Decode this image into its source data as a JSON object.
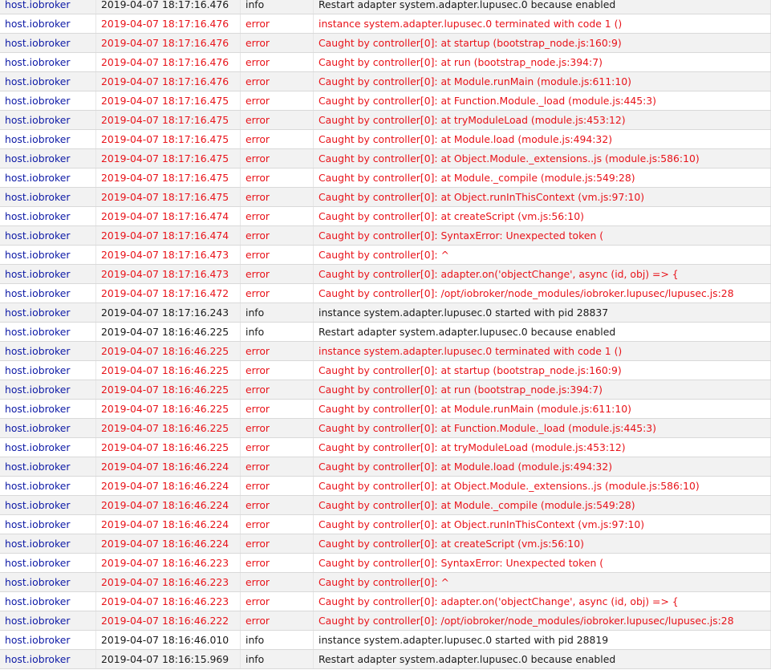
{
  "colors": {
    "source": "#0d1aa6",
    "error": "#e8131a",
    "info": "#1a1a1a",
    "row_alt": "#f2f2f2"
  },
  "log": {
    "rows": [
      {
        "source": "host.iobroker",
        "time": "2019-04-07 18:17:16.476",
        "severity": "info",
        "message": "Restart adapter system.adapter.lupusec.0 because enabled"
      },
      {
        "source": "host.iobroker",
        "time": "2019-04-07 18:17:16.476",
        "severity": "error",
        "message": "instance system.adapter.lupusec.0 terminated with code 1 ()"
      },
      {
        "source": "host.iobroker",
        "time": "2019-04-07 18:17:16.476",
        "severity": "error",
        "message": "Caught by controller[0]: at startup (bootstrap_node.js:160:9)"
      },
      {
        "source": "host.iobroker",
        "time": "2019-04-07 18:17:16.476",
        "severity": "error",
        "message": "Caught by controller[0]: at run (bootstrap_node.js:394:7)"
      },
      {
        "source": "host.iobroker",
        "time": "2019-04-07 18:17:16.476",
        "severity": "error",
        "message": "Caught by controller[0]: at Module.runMain (module.js:611:10)"
      },
      {
        "source": "host.iobroker",
        "time": "2019-04-07 18:17:16.475",
        "severity": "error",
        "message": "Caught by controller[0]: at Function.Module._load (module.js:445:3)"
      },
      {
        "source": "host.iobroker",
        "time": "2019-04-07 18:17:16.475",
        "severity": "error",
        "message": "Caught by controller[0]: at tryModuleLoad (module.js:453:12)"
      },
      {
        "source": "host.iobroker",
        "time": "2019-04-07 18:17:16.475",
        "severity": "error",
        "message": "Caught by controller[0]: at Module.load (module.js:494:32)"
      },
      {
        "source": "host.iobroker",
        "time": "2019-04-07 18:17:16.475",
        "severity": "error",
        "message": "Caught by controller[0]: at Object.Module._extensions..js (module.js:586:10)"
      },
      {
        "source": "host.iobroker",
        "time": "2019-04-07 18:17:16.475",
        "severity": "error",
        "message": "Caught by controller[0]: at Module._compile (module.js:549:28)"
      },
      {
        "source": "host.iobroker",
        "time": "2019-04-07 18:17:16.475",
        "severity": "error",
        "message": "Caught by controller[0]: at Object.runInThisContext (vm.js:97:10)"
      },
      {
        "source": "host.iobroker",
        "time": "2019-04-07 18:17:16.474",
        "severity": "error",
        "message": "Caught by controller[0]: at createScript (vm.js:56:10)"
      },
      {
        "source": "host.iobroker",
        "time": "2019-04-07 18:17:16.474",
        "severity": "error",
        "message": "Caught by controller[0]: SyntaxError: Unexpected token ("
      },
      {
        "source": "host.iobroker",
        "time": "2019-04-07 18:17:16.473",
        "severity": "error",
        "message": "Caught by controller[0]: ^"
      },
      {
        "source": "host.iobroker",
        "time": "2019-04-07 18:17:16.473",
        "severity": "error",
        "message": "Caught by controller[0]: adapter.on('objectChange', async (id, obj) => {"
      },
      {
        "source": "host.iobroker",
        "time": "2019-04-07 18:17:16.472",
        "severity": "error",
        "message": "Caught by controller[0]: /opt/iobroker/node_modules/iobroker.lupusec/lupusec.js:28"
      },
      {
        "source": "host.iobroker",
        "time": "2019-04-07 18:17:16.243",
        "severity": "info",
        "message": "instance system.adapter.lupusec.0 started with pid 28837"
      },
      {
        "source": "host.iobroker",
        "time": "2019-04-07 18:16:46.225",
        "severity": "info",
        "message": "Restart adapter system.adapter.lupusec.0 because enabled"
      },
      {
        "source": "host.iobroker",
        "time": "2019-04-07 18:16:46.225",
        "severity": "error",
        "message": "instance system.adapter.lupusec.0 terminated with code 1 ()"
      },
      {
        "source": "host.iobroker",
        "time": "2019-04-07 18:16:46.225",
        "severity": "error",
        "message": "Caught by controller[0]: at startup (bootstrap_node.js:160:9)"
      },
      {
        "source": "host.iobroker",
        "time": "2019-04-07 18:16:46.225",
        "severity": "error",
        "message": "Caught by controller[0]: at run (bootstrap_node.js:394:7)"
      },
      {
        "source": "host.iobroker",
        "time": "2019-04-07 18:16:46.225",
        "severity": "error",
        "message": "Caught by controller[0]: at Module.runMain (module.js:611:10)"
      },
      {
        "source": "host.iobroker",
        "time": "2019-04-07 18:16:46.225",
        "severity": "error",
        "message": "Caught by controller[0]: at Function.Module._load (module.js:445:3)"
      },
      {
        "source": "host.iobroker",
        "time": "2019-04-07 18:16:46.225",
        "severity": "error",
        "message": "Caught by controller[0]: at tryModuleLoad (module.js:453:12)"
      },
      {
        "source": "host.iobroker",
        "time": "2019-04-07 18:16:46.224",
        "severity": "error",
        "message": "Caught by controller[0]: at Module.load (module.js:494:32)"
      },
      {
        "source": "host.iobroker",
        "time": "2019-04-07 18:16:46.224",
        "severity": "error",
        "message": "Caught by controller[0]: at Object.Module._extensions..js (module.js:586:10)"
      },
      {
        "source": "host.iobroker",
        "time": "2019-04-07 18:16:46.224",
        "severity": "error",
        "message": "Caught by controller[0]: at Module._compile (module.js:549:28)"
      },
      {
        "source": "host.iobroker",
        "time": "2019-04-07 18:16:46.224",
        "severity": "error",
        "message": "Caught by controller[0]: at Object.runInThisContext (vm.js:97:10)"
      },
      {
        "source": "host.iobroker",
        "time": "2019-04-07 18:16:46.224",
        "severity": "error",
        "message": "Caught by controller[0]: at createScript (vm.js:56:10)"
      },
      {
        "source": "host.iobroker",
        "time": "2019-04-07 18:16:46.223",
        "severity": "error",
        "message": "Caught by controller[0]: SyntaxError: Unexpected token ("
      },
      {
        "source": "host.iobroker",
        "time": "2019-04-07 18:16:46.223",
        "severity": "error",
        "message": "Caught by controller[0]: ^"
      },
      {
        "source": "host.iobroker",
        "time": "2019-04-07 18:16:46.223",
        "severity": "error",
        "message": "Caught by controller[0]: adapter.on('objectChange', async (id, obj) => {"
      },
      {
        "source": "host.iobroker",
        "time": "2019-04-07 18:16:46.222",
        "severity": "error",
        "message": "Caught by controller[0]: /opt/iobroker/node_modules/iobroker.lupusec/lupusec.js:28"
      },
      {
        "source": "host.iobroker",
        "time": "2019-04-07 18:16:46.010",
        "severity": "info",
        "message": "instance system.adapter.lupusec.0 started with pid 28819"
      },
      {
        "source": "host.iobroker",
        "time": "2019-04-07 18:16:15.969",
        "severity": "info",
        "message": "Restart adapter system.adapter.lupusec.0 because enabled"
      }
    ]
  }
}
